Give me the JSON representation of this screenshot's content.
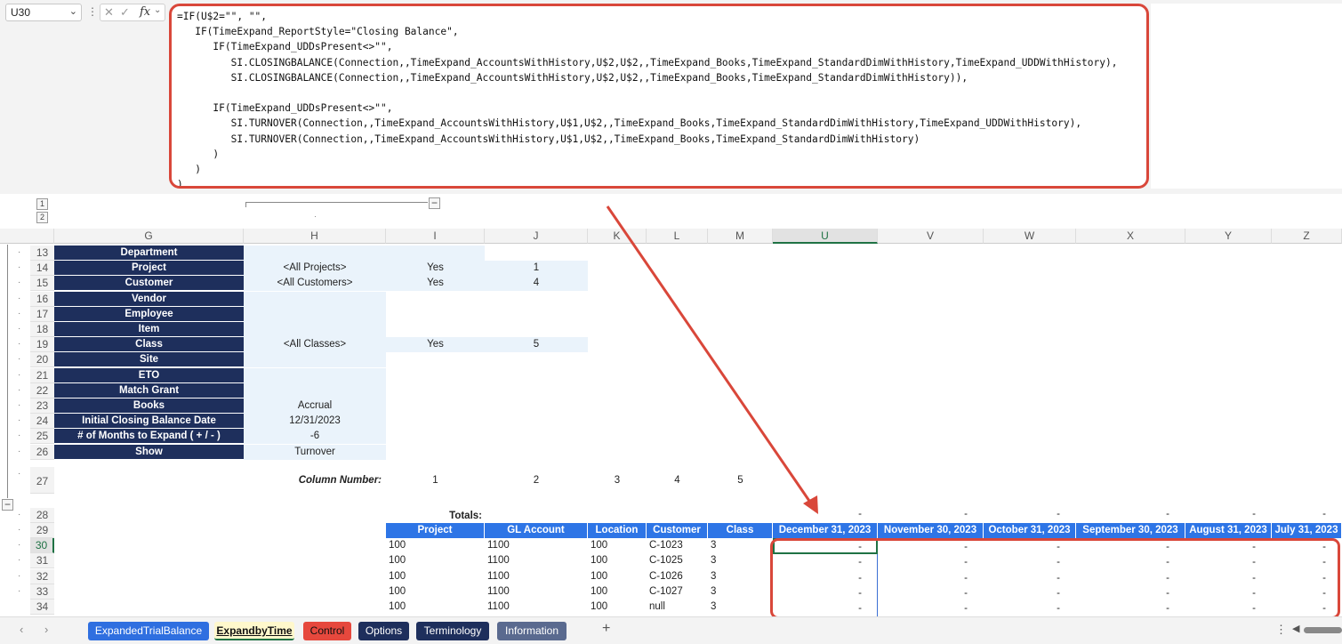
{
  "formula_bar": {
    "name_box": "U30",
    "fx_label": "fx",
    "formula_lines": [
      "=IF(U$2=\"\", \"\",",
      "   IF(TimeExpand_ReportStyle=\"Closing Balance\",",
      "      IF(TimeExpand_UDDsPresent<>\"\",",
      "         SI.CLOSINGBALANCE(Connection,,TimeExpand_AccountsWithHistory,U$2,U$2,,TimeExpand_Books,TimeExpand_StandardDimWithHistory,TimeExpand_UDDWithHistory),",
      "         SI.CLOSINGBALANCE(Connection,,TimeExpand_AccountsWithHistory,U$2,U$2,,TimeExpand_Books,TimeExpand_StandardDimWithHistory)),",
      "",
      "      IF(TimeExpand_UDDsPresent<>\"\",",
      "         SI.TURNOVER(Connection,,TimeExpand_AccountsWithHistory,U$1,U$2,,TimeExpand_Books,TimeExpand_StandardDimWithHistory,TimeExpand_UDDWithHistory),",
      "         SI.TURNOVER(Connection,,TimeExpand_AccountsWithHistory,U$1,U$2,,TimeExpand_Books,TimeExpand_StandardDimWithHistory)",
      "      )",
      "   )",
      ")"
    ]
  },
  "outline": {
    "levels": [
      "1",
      "2"
    ],
    "collapse_symbol": "−"
  },
  "columns": [
    "G",
    "H",
    "I",
    "J",
    "K",
    "L",
    "M",
    "U",
    "V",
    "W",
    "X",
    "Y",
    "Z"
  ],
  "rows": [
    "13",
    "14",
    "15",
    "16",
    "17",
    "18",
    "19",
    "20",
    "21",
    "22",
    "23",
    "24",
    "25",
    "26",
    "27",
    "28",
    "29",
    "30",
    "31",
    "32",
    "33",
    "34"
  ],
  "settings": [
    {
      "label": "Department",
      "value": "",
      "flag": "",
      "num": ""
    },
    {
      "label": "Project",
      "value": "<All Projects>",
      "flag": "Yes",
      "num": "1"
    },
    {
      "label": "Customer",
      "value": "<All Customers>",
      "flag": "Yes",
      "num": "4"
    },
    {
      "label": "Vendor",
      "value": "",
      "flag": "",
      "num": ""
    },
    {
      "label": "Employee",
      "value": "",
      "flag": "",
      "num": ""
    },
    {
      "label": "Item",
      "value": "",
      "flag": "",
      "num": ""
    },
    {
      "label": "Class",
      "value": "<All Classes>",
      "flag": "Yes",
      "num": "5"
    },
    {
      "label": "Site",
      "value": "",
      "flag": "",
      "num": ""
    },
    {
      "label": "ETO",
      "value": "",
      "flag": "",
      "num": ""
    },
    {
      "label": "Match Grant",
      "value": "",
      "flag": "",
      "num": ""
    },
    {
      "label": "Books",
      "value": "Accrual",
      "flag": "",
      "num": ""
    },
    {
      "label": "Initial Closing Balance Date",
      "value": "12/31/2023",
      "flag": "",
      "num": ""
    },
    {
      "label": "# of Months to Expand ( + / - )",
      "value": "-6",
      "flag": "",
      "num": ""
    },
    {
      "label": "Show",
      "value": "Turnover",
      "flag": "",
      "num": ""
    }
  ],
  "column_number": {
    "label": "Column Number:",
    "values": [
      "1",
      "2",
      "3",
      "4",
      "5"
    ]
  },
  "totals": {
    "label": "Totals:",
    "values": [
      "-",
      "-",
      "-",
      "-",
      "-",
      "-"
    ]
  },
  "table_headers": [
    "Project",
    "GL Account",
    "Location",
    "Customer",
    "Class",
    "December 31, 2023",
    "November 30, 2023",
    "October 31, 2023",
    "September 30, 2023",
    "August 31, 2023",
    "July 31, 2023"
  ],
  "table_rows": [
    {
      "cells": [
        "100",
        "1100",
        "100",
        "C-1023",
        "3"
      ],
      "values": [
        "-",
        "-",
        "-",
        "-",
        "-",
        "-"
      ]
    },
    {
      "cells": [
        "100",
        "1100",
        "100",
        "C-1025",
        "3"
      ],
      "values": [
        "-",
        "-",
        "-",
        "-",
        "-",
        "-"
      ]
    },
    {
      "cells": [
        "100",
        "1100",
        "100",
        "C-1026",
        "3"
      ],
      "values": [
        "-",
        "-",
        "-",
        "-",
        "-",
        "-"
      ]
    },
    {
      "cells": [
        "100",
        "1100",
        "100",
        "C-1027",
        "3"
      ],
      "values": [
        "-",
        "-",
        "-",
        "-",
        "-",
        "-"
      ]
    },
    {
      "cells": [
        "100",
        "1100",
        "100",
        "null",
        "3"
      ],
      "values": [
        "-",
        "-",
        "-",
        "-",
        "-",
        "-"
      ]
    }
  ],
  "tabs": [
    {
      "label": "ExpandedTrialBalance",
      "color": "#2f6fe0"
    },
    {
      "label": "ExpandbyTime",
      "color": "#fff8cc"
    },
    {
      "label": "Control",
      "color": "#e6483d"
    },
    {
      "label": "Options",
      "color": "#1e2f5c"
    },
    {
      "label": "Terminology",
      "color": "#1e2f5c"
    },
    {
      "label": "Information",
      "color": "#5a6a8f"
    }
  ],
  "tab_add": "+",
  "colors": {
    "annotation": "#d9473a",
    "navy": "#1e2f5c",
    "header_blue": "#2e75e6"
  }
}
